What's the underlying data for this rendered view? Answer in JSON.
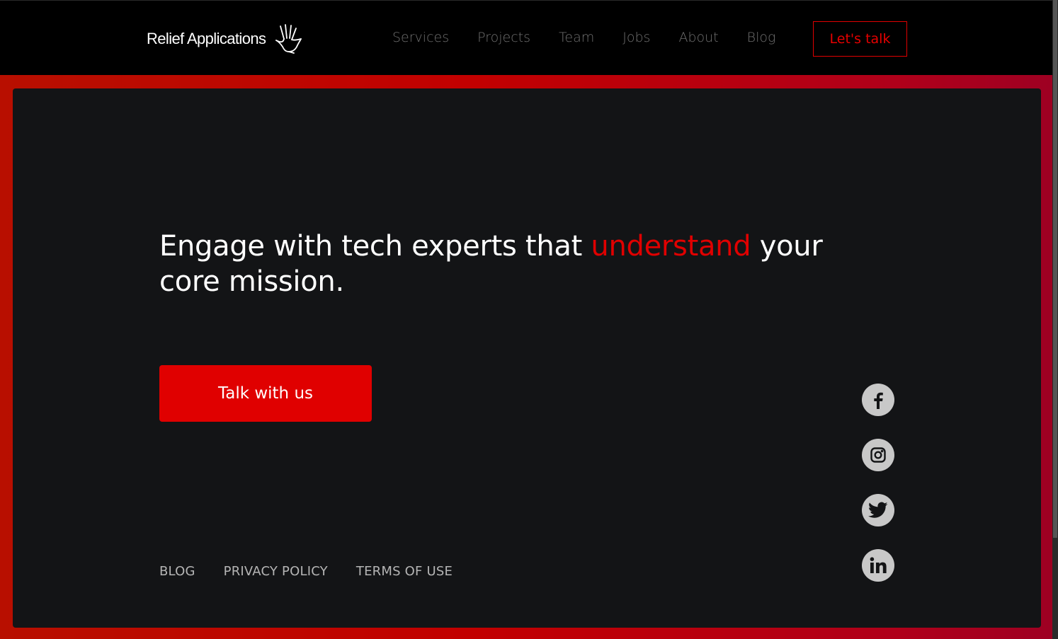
{
  "brand": {
    "name": "Relief Applications",
    "logo_icon": "hand-icon"
  },
  "nav": {
    "items": [
      {
        "label": "Services"
      },
      {
        "label": "Projects"
      },
      {
        "label": "Team"
      },
      {
        "label": "Jobs"
      },
      {
        "label": "About"
      },
      {
        "label": "Blog"
      }
    ],
    "cta_label": "Let's talk"
  },
  "hero": {
    "headline_before": "Engage with tech experts that ",
    "headline_accent": "understand",
    "headline_after": " your core mission.",
    "cta_label": "Talk with us"
  },
  "footer": {
    "links": [
      {
        "label": "BLOG"
      },
      {
        "label": "PRIVACY POLICY"
      },
      {
        "label": "TERMS OF USE"
      }
    ]
  },
  "social": [
    "facebook-icon",
    "instagram-icon",
    "twitter-icon",
    "linkedin-icon"
  ],
  "colors": {
    "accent": "#e00000",
    "background": "#000000",
    "card": "#131416",
    "frame": "#c20000",
    "nav_text": "#6f6f6f",
    "social_bg": "#c8c8c8"
  }
}
